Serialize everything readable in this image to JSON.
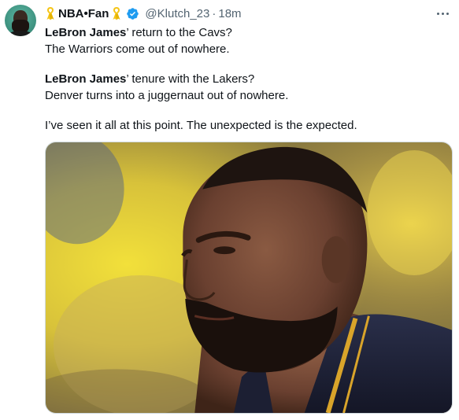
{
  "author": {
    "name": "NBA•Fan",
    "handle": "@Klutch_23",
    "separator": "·",
    "time": "18m",
    "verified": true,
    "avatar_icon": "profile-avatar",
    "badge_icon": "yellow-ribbon-icon"
  },
  "tweet": {
    "para1_name": "LeBron James",
    "para1_rest": "’ return to the Cavs?",
    "para1_line2": "The Warriors come out of nowhere.",
    "para2_name": "LeBron James",
    "para2_rest": "’ tenure with the Lakers?",
    "para2_line2": "Denver turns into a juggernaut out of nowhere.",
    "para3": "I’ve seen it all at this point. The unexpected is the expected."
  },
  "media": {
    "description_icon": "photo-basketball-player-closeup"
  },
  "colors": {
    "text": "#0f1419",
    "muted": "#536471",
    "verified_blue": "#1d9bf0",
    "ribbon_yellow": "#f5c518"
  }
}
